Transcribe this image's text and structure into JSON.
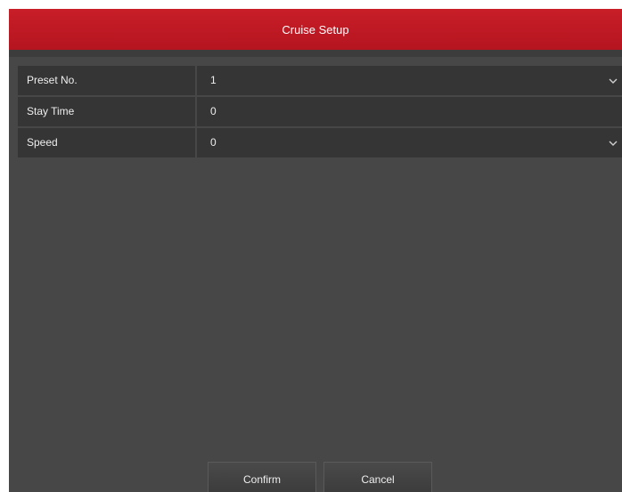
{
  "dialog": {
    "title": "Cruise Setup"
  },
  "form": {
    "rows": [
      {
        "label": "Preset No.",
        "value": "1",
        "has_dropdown": true
      },
      {
        "label": "Stay Time",
        "value": "0",
        "has_dropdown": false
      },
      {
        "label": "Speed",
        "value": "0",
        "has_dropdown": true
      }
    ]
  },
  "buttons": {
    "confirm": "Confirm",
    "cancel": "Cancel"
  },
  "colors": {
    "title_bar": "#c0171f",
    "panel": "#474747",
    "field": "#353535",
    "text": "#eeeeee"
  },
  "icons": {
    "dropdown": "chevron-down-icon"
  }
}
